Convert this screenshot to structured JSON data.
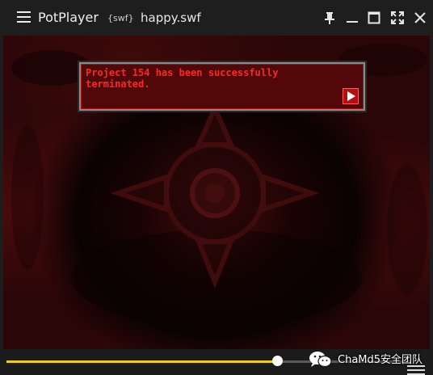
{
  "titlebar": {
    "app_name": "PotPlayer",
    "file_type": "{swf}",
    "file_name": "happy.swf",
    "icons": [
      "menu-icon",
      "pin-icon",
      "minimize-icon",
      "maximize-icon",
      "fullscreen-icon",
      "close-icon"
    ]
  },
  "video": {
    "dialog_text": "Project 154 has been successfully\nterminated.",
    "dialog_next_icon": "play-triangle-icon"
  },
  "controls": {
    "seek_progress": 0.67,
    "playlist_icon": "playlist-icon"
  },
  "watermark": {
    "text": "ChaMd5安全团队",
    "icon": "wechat-icon"
  },
  "colors": {
    "titlebar_bg": "#1e1e1e",
    "seek_accent": "#f0cc1a",
    "dialog_bg": "#520709",
    "dialog_text": "#ff2626"
  }
}
